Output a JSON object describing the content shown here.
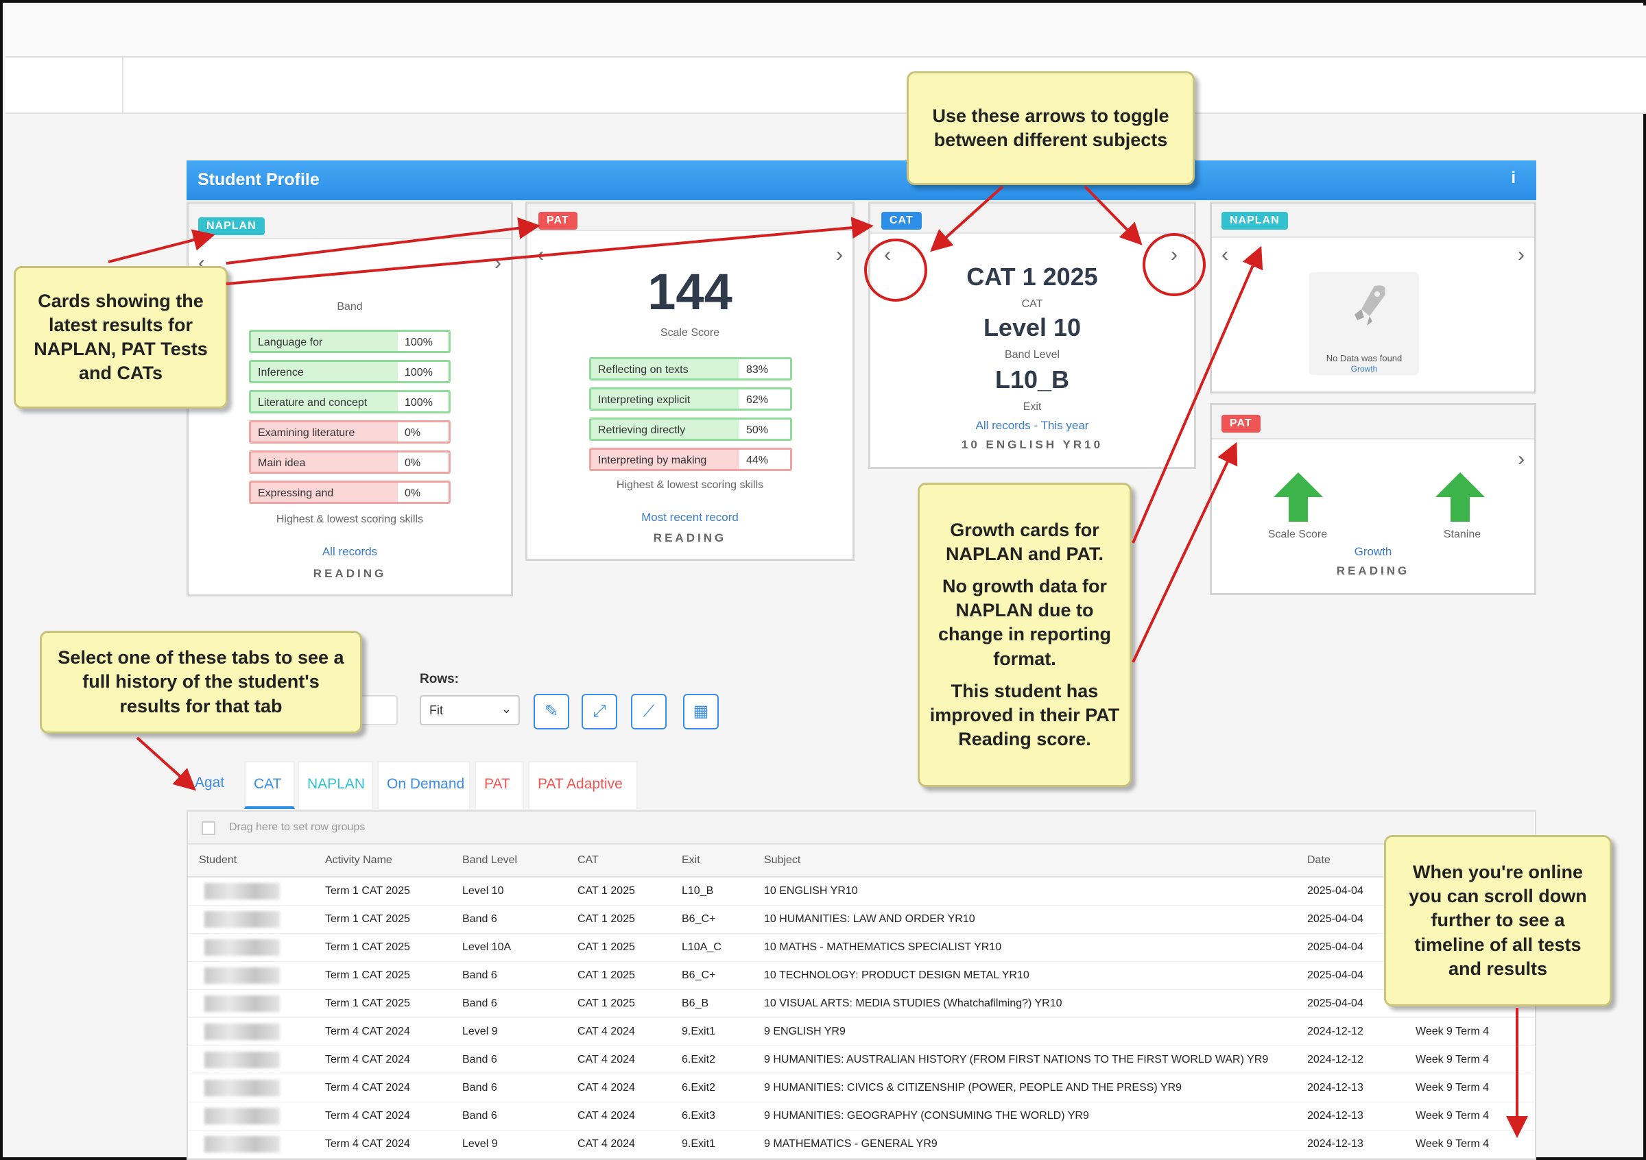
{
  "header": {
    "title": "Student Profile",
    "info_icon": "i"
  },
  "cards": {
    "naplan": {
      "badge": "NAPLAN",
      "value_label": "Band",
      "skills": [
        {
          "name": "Language for",
          "value": "100%",
          "status": "good"
        },
        {
          "name": "Inference",
          "value": "100%",
          "status": "good"
        },
        {
          "name": "Literature and concept",
          "value": "100%",
          "status": "good"
        },
        {
          "name": "Examining literature",
          "value": "0%",
          "status": "bad"
        },
        {
          "name": "Main idea",
          "value": "0%",
          "status": "bad"
        },
        {
          "name": "Expressing and",
          "value": "0%",
          "status": "bad"
        }
      ],
      "skills_caption": "Highest & lowest scoring skills",
      "link": "All records",
      "subject": "READING"
    },
    "pat": {
      "badge": "PAT",
      "value": "144",
      "value_label": "Scale Score",
      "skills": [
        {
          "name": "Reflecting on texts",
          "value": "83%",
          "status": "good"
        },
        {
          "name": "Interpreting explicit",
          "value": "62%",
          "status": "good"
        },
        {
          "name": "Retrieving directly",
          "value": "50%",
          "status": "good"
        },
        {
          "name": "Interpreting by making",
          "value": "44%",
          "status": "bad"
        }
      ],
      "skills_caption": "Highest & lowest scoring skills",
      "link": "Most recent record",
      "subject": "READING"
    },
    "cat": {
      "badge": "CAT",
      "title": "CAT 1 2025",
      "title_label": "CAT",
      "level": "Level 10",
      "level_label": "Band Level",
      "exit": "L10_B",
      "exit_label": "Exit",
      "link": "All records - This year",
      "subject": "10 ENGLISH YR10"
    },
    "naplan_growth": {
      "badge": "NAPLAN",
      "message": "No Data was found",
      "sub": "Growth"
    },
    "pat_growth": {
      "badge": "PAT",
      "left_label": "Scale Score",
      "right_label": "Stanine",
      "link": "Growth",
      "subject": "READING"
    }
  },
  "callouts": {
    "arrows": "Use these arrows to toggle between different subjects",
    "cards": "Cards showing the latest results for NAPLAN, PAT Tests and CATs",
    "growth_1": "Growth cards for NAPLAN and PAT.",
    "growth_2": "No growth data for NAPLAN due to change in reporting format.",
    "growth_3": "This student has improved in their PAT Reading score.",
    "tabs": "Select one of these tabs to see a full history of the student's results for that tab",
    "scroll": "When you're online you can scroll down further to see a timeline of all tests and results"
  },
  "controls": {
    "rows_label": "Rows:",
    "rows_value": "Fit",
    "tools": [
      "pencil-icon",
      "expand-icon",
      "chart-icon",
      "export-icon"
    ]
  },
  "tabs": [
    "Agat",
    "CAT",
    "NAPLAN",
    "On Demand",
    "PAT",
    "PAT Adaptive"
  ],
  "grid": {
    "group_hint": "Drag here to set row groups",
    "columns": [
      "Student",
      "Activity Name",
      "Band Level",
      "CAT",
      "Exit",
      "Subject",
      "Date"
    ],
    "rows": [
      {
        "activity": "Term 1 CAT 2025",
        "band": "Level 10",
        "cat": "CAT 1 2025",
        "exit": "L10_B",
        "subject": "10 ENGLISH YR10",
        "date": "2025-04-04",
        "week": ""
      },
      {
        "activity": "Term 1 CAT 2025",
        "band": "Band 6",
        "cat": "CAT 1 2025",
        "exit": "B6_C+",
        "subject": "10 HUMANITIES: LAW AND ORDER YR10",
        "date": "2025-04-04",
        "week": ""
      },
      {
        "activity": "Term 1 CAT 2025",
        "band": "Level 10A",
        "cat": "CAT 1 2025",
        "exit": "L10A_C",
        "subject": "10 MATHS - MATHEMATICS SPECIALIST YR10",
        "date": "2025-04-04",
        "week": ""
      },
      {
        "activity": "Term 1 CAT 2025",
        "band": "Band 6",
        "cat": "CAT 1 2025",
        "exit": "B6_C+",
        "subject": "10 TECHNOLOGY: PRODUCT DESIGN METAL YR10",
        "date": "2025-04-04",
        "week": ""
      },
      {
        "activity": "Term 1 CAT 2025",
        "band": "Band 6",
        "cat": "CAT 1 2025",
        "exit": "B6_B",
        "subject": "10 VISUAL ARTS: MEDIA STUDIES (Whatchafilming?) YR10",
        "date": "2025-04-04",
        "week": ""
      },
      {
        "activity": "Term 4 CAT 2024",
        "band": "Level 9",
        "cat": "CAT 4 2024",
        "exit": "9.Exit1",
        "subject": "9 ENGLISH YR9",
        "date": "2024-12-12",
        "week": "Week 9 Term 4"
      },
      {
        "activity": "Term 4 CAT 2024",
        "band": "Band 6",
        "cat": "CAT 4 2024",
        "exit": "6.Exit2",
        "subject": "9 HUMANITIES: AUSTRALIAN HISTORY (FROM FIRST NATIONS TO THE FIRST WORLD WAR) YR9",
        "date": "2024-12-12",
        "week": "Week 9 Term 4"
      },
      {
        "activity": "Term 4 CAT 2024",
        "band": "Band 6",
        "cat": "CAT 4 2024",
        "exit": "6.Exit2",
        "subject": "9 HUMANITIES: CIVICS & CITIZENSHIP (POWER, PEOPLE AND THE PRESS) YR9",
        "date": "2024-12-13",
        "week": "Week 9 Term 4"
      },
      {
        "activity": "Term 4 CAT 2024",
        "band": "Band 6",
        "cat": "CAT 4 2024",
        "exit": "6.Exit3",
        "subject": "9 HUMANITIES: GEOGRAPHY (CONSUMING THE WORLD) YR9",
        "date": "2024-12-13",
        "week": "Week 9 Term 4"
      },
      {
        "activity": "Term 4 CAT 2024",
        "band": "Level 9",
        "cat": "CAT 4 2024",
        "exit": "9.Exit1",
        "subject": "9 MATHEMATICS - GENERAL YR9",
        "date": "2024-12-13",
        "week": "Week 9 Term 4"
      }
    ]
  }
}
